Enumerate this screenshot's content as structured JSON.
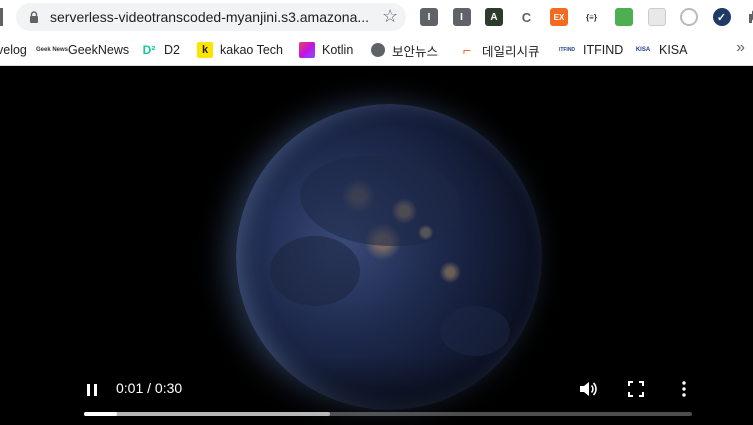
{
  "browser": {
    "url": "serverless-videotranscoded-myanjini.s3.amazona...",
    "extensions": [
      {
        "icon": "extension-gray-icon",
        "label": "I",
        "color": "#5f6368"
      },
      {
        "icon": "extension-gray-icon",
        "label": "I",
        "color": "#5f6368"
      },
      {
        "icon": "extension-dark-icon",
        "label": "A",
        "color": "#2d3b2d"
      },
      {
        "icon": "extension-c-icon",
        "label": "C",
        "color": "#ffffff"
      },
      {
        "icon": "extension-ex-icon",
        "label": "EX",
        "color": "#f26b21"
      },
      {
        "icon": "extension-json-icon",
        "label": "{≡}",
        "color": "#ffffff"
      },
      {
        "icon": "extension-printer-icon",
        "label": "",
        "color": "#4caf50"
      },
      {
        "icon": "extension-grid-icon",
        "label": "",
        "color": "#e8e8e8"
      },
      {
        "icon": "extension-ring-icon",
        "label": "",
        "color": "#ffffff"
      },
      {
        "icon": "extension-check-icon",
        "label": "✓",
        "color": "#1f3a66"
      },
      {
        "icon": "extensions-puzzle-icon",
        "label": "",
        "color": "#ffffff"
      }
    ]
  },
  "bookmarks": [
    {
      "label": "velog",
      "icon": ""
    },
    {
      "label": "GeekNews",
      "icon": "Geek News"
    },
    {
      "label": "D2",
      "icon": "D²"
    },
    {
      "label": "kakao Tech",
      "icon": "k"
    },
    {
      "label": "Kotlin",
      "icon": "◣"
    },
    {
      "label": "보안뉴스",
      "icon": "🌐"
    },
    {
      "label": "데일리시큐",
      "icon": "⌐"
    },
    {
      "label": "ITFIND",
      "icon": "ITFIND"
    },
    {
      "label": "KISA",
      "icon": "KISA"
    }
  ],
  "bookmarks_more": "»",
  "video": {
    "current_time": "0:01",
    "duration": "0:30",
    "time_display": "0:01 / 0:30",
    "played_fraction": 0.055,
    "buffered_fraction": 0.405
  },
  "colors": {
    "chrome_bg": "#ffffff",
    "omnibox_bg": "#f1f3f4",
    "video_bg": "#000000"
  }
}
